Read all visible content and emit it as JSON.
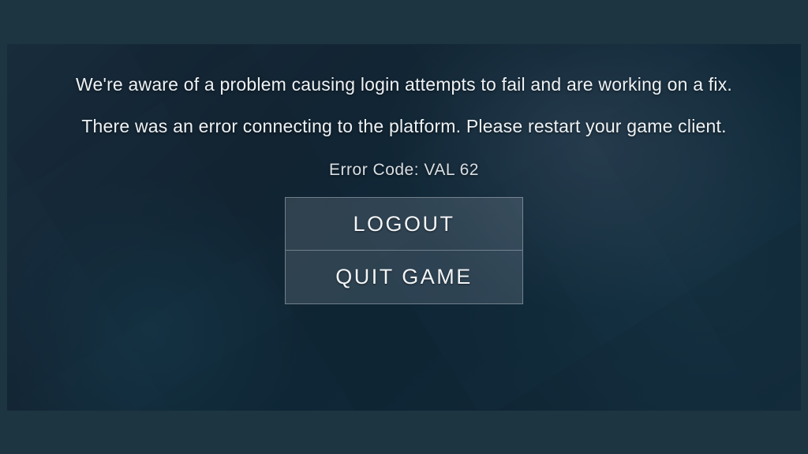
{
  "error": {
    "awareness_message": "We're aware of a problem causing login attempts to fail and are working on a fix.",
    "connection_message": "There was an error connecting to the platform. Please restart your game client.",
    "code_label": "Error Code: VAL 62"
  },
  "buttons": {
    "logout": "LOGOUT",
    "quit": "QUIT GAME"
  }
}
